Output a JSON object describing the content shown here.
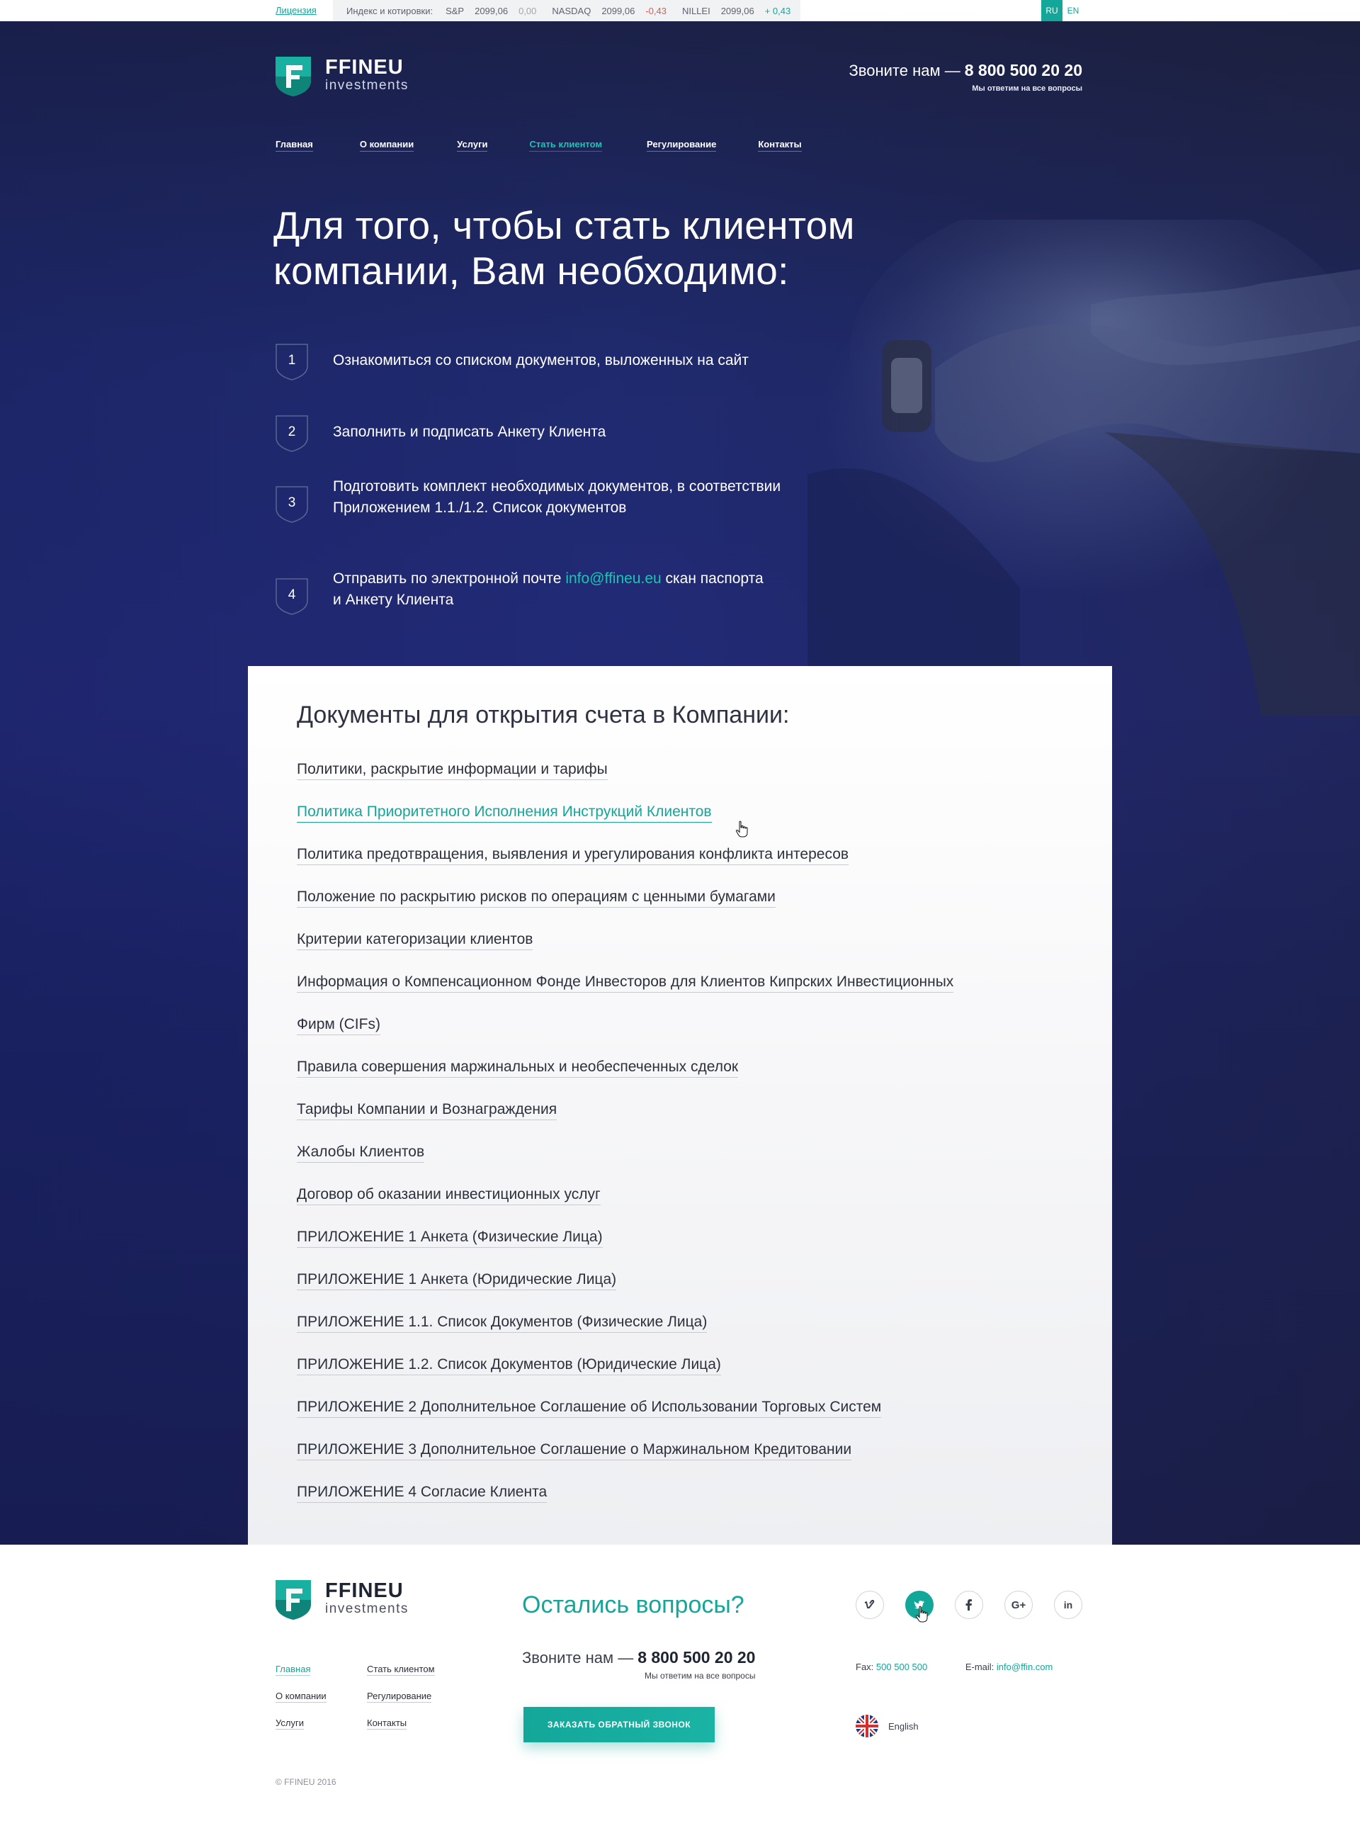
{
  "topbar": {
    "license": "Лицензия",
    "indexes_label": "Индекс и котировки:",
    "quotes": [
      {
        "name": "S&P",
        "value": "2099,06",
        "change": "0,00",
        "trend": "neutral"
      },
      {
        "name": "NASDAQ",
        "value": "2099,06",
        "change": "-0,43",
        "trend": "neg"
      },
      {
        "name": "NILLEI",
        "value": "2099,06",
        "change": "+ 0,43",
        "trend": "pos"
      }
    ],
    "lang_ru": "RU",
    "lang_en": "EN"
  },
  "brand": {
    "name": "FFINEU",
    "sub": "investments"
  },
  "header": {
    "call_label": "Звоните нам —",
    "phone": "8 800 500 20 20",
    "hint": "Мы ответим на все вопросы"
  },
  "nav": [
    {
      "label": "Главная",
      "active": false
    },
    {
      "label": "О компании",
      "active": false
    },
    {
      "label": "Услуги",
      "active": false
    },
    {
      "label": "Стать клиентом",
      "active": true
    },
    {
      "label": "Регулирование",
      "active": false
    },
    {
      "label": "Контакты",
      "active": false
    }
  ],
  "hero": {
    "title_line1": "Для того, чтобы стать клиентом",
    "title_line2": "компании, Вам необходимо:",
    "steps": [
      {
        "num": "1",
        "line1": "Ознакомиться со списком документов, выложенных на сайт",
        "line2": ""
      },
      {
        "num": "2",
        "line1": "Заполнить и подписать Анкету Клиента",
        "line2": ""
      },
      {
        "num": "3",
        "line1": "Подготовить комплект необходимых документов, в соответствии",
        "line2": "Приложением 1.1./1.2. Список документов"
      },
      {
        "num": "4",
        "pre": "Отправить по электронной почте ",
        "link": "info@ffineu.eu",
        "post": " скан паспорта",
        "line2": "и Анкету Клиента"
      }
    ]
  },
  "documents": {
    "title": "Документы для открытия счета в Компании:",
    "items": [
      "Политики, раскрытие информации и тарифы",
      "Политика Приоритетного Исполнения Инструкций Клиентов",
      "Политика предотвращения, выявления и урегулирования конфликта интересов",
      "Положение по раскрытию рисков по операциям с ценными бумагами",
      "Критерии категоризации клиентов",
      "Информация о Компенсационном Фонде Инвесторов для Клиентов Кипрских Инвестиционных",
      "Фирм (CIFs)",
      "Правила совершения маржинальных и необеспеченных сделок",
      "Тарифы Компании и Вознаграждения",
      "Жалобы Клиентов",
      "Договор об оказании инвестиционных услуг",
      "ПРИЛОЖЕНИЕ 1 Анкета (Физические Лица)",
      "ПРИЛОЖЕНИЕ 1 Анкета (Юридические Лица)",
      "ПРИЛОЖЕНИЕ 1.1. Список Документов (Физические Лица)",
      "ПРИЛОЖЕНИЕ 1.2. Список Документов (Юридические Лица)",
      "ПРИЛОЖЕНИЕ 2 Дополнительное Соглашение об Использовании Торговых Систем",
      "ПРИЛОЖЕНИЕ 3 Дополнительное Соглашение о Маржинальном Кредитовании",
      "ПРИЛОЖЕНИЕ 4 Согласие Клиента"
    ]
  },
  "footer": {
    "nav_col1": [
      "Главная",
      "О компании",
      "Услуги"
    ],
    "nav_col2": [
      "Стать клиентом",
      "Регулирование",
      "Контакты"
    ],
    "question": "Остались вопросы?",
    "callback_button": "ЗАКАЗАТЬ ОБРАТНЫЙ ЗВОНОК",
    "social_icons": [
      "vimeo-icon",
      "twitter-icon",
      "facebook-icon",
      "google-plus-icon",
      "linkedin-icon"
    ],
    "fax_label": "Fax:",
    "fax": "500 500 500",
    "email_label": "E-mail:",
    "email": "info@ffin.com",
    "language": "English",
    "copyright": "© FFINEU 2016"
  },
  "colors": {
    "accent": "#13a79a",
    "hero_dark": "#1b2148",
    "negative": "#e4574e"
  }
}
